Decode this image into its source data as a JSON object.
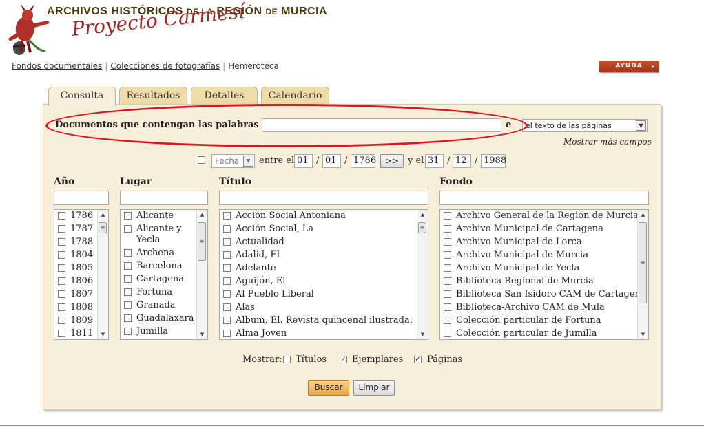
{
  "header": {
    "title_parts": [
      "ARCHIVOS HISTÓRICOS",
      "DE LA",
      "REGIÓN",
      "DE",
      "MURCIA"
    ],
    "subtitle": "Proyecto Carmesí"
  },
  "topnav": {
    "items": [
      "Fondos documentales",
      "Colecciones de fotografías",
      "Hemeroteca"
    ],
    "help_label": "AYUDA"
  },
  "tabs": [
    "Consulta",
    "Resultados",
    "Detalles",
    "Calendario"
  ],
  "search": {
    "label": "Documentos que contengan las palabras",
    "value": "",
    "in_label": "e",
    "scope_selected": "el texto de las páginas",
    "more_fields": "Mostrar más campos"
  },
  "date_filter": {
    "field_selected": "Fecha",
    "between_label": "entre el",
    "from": {
      "d": "01",
      "m": "01",
      "y": "1786"
    },
    "go_label": ">>",
    "and_label": "y el",
    "to": {
      "d": "31",
      "m": "12",
      "y": "1988"
    },
    "slash": "/"
  },
  "facets": {
    "year": {
      "label": "Año",
      "items": [
        "1786",
        "1787",
        "1788",
        "1804",
        "1805",
        "1806",
        "1807",
        "1808",
        "1809",
        "1811"
      ]
    },
    "place": {
      "label": "Lugar",
      "items": [
        "Alicante",
        "Alicante y Yecla",
        "Archena",
        "Barcelona",
        "Cartagena",
        "Fortuna",
        "Granada",
        "Guadalaxara",
        "Jumilla"
      ]
    },
    "title": {
      "label": "Título",
      "items": [
        "Acción Social Antoniana",
        "Acción Social, La",
        "Actualidad",
        "Adalid, El",
        "Adelante",
        "Aguijón, El",
        "Al Pueblo Liberal",
        "Alas",
        "Album, El. Revista quincenal ilustrada.",
        "Alma Joven"
      ]
    },
    "fondo": {
      "label": "Fondo",
      "items": [
        "Archivo General de la Región de Murcia",
        "Archivo Municipal de Cartagena",
        "Archivo Municipal de Lorca",
        "Archivo Municipal de Murcia",
        "Archivo Municipal de Yecla",
        "Biblioteca Regional de Murcia",
        "Biblioteca San Isidoro CAM de Cartagena",
        "Biblioteca-Archivo CAM de Mula",
        "Colección particular de Fortuna",
        "Colección particular de Jumilla"
      ]
    }
  },
  "show": {
    "label": "Mostrar:",
    "options": [
      {
        "label": "Títulos",
        "checked": false
      },
      {
        "label": "Ejemplares",
        "checked": true
      },
      {
        "label": "Páginas",
        "checked": true
      }
    ]
  },
  "actions": {
    "search_label": "Buscar",
    "clear_label": "Limpiar"
  },
  "colors": {
    "accent_red": "#e0141e",
    "panel_bg": "#f7efd9",
    "tab_bg": "#f0dca8",
    "help_bg": "#b8401f",
    "search_btn": "#eaa640"
  }
}
